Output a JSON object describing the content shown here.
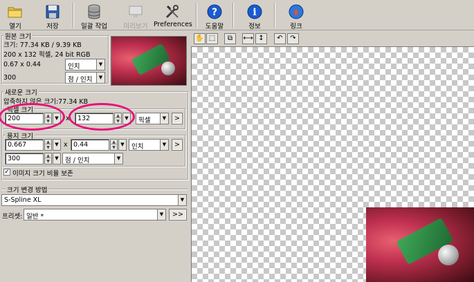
{
  "toolbar": {
    "open": "열기",
    "save": "저장",
    "batch": "일괄 작업",
    "preview": "미리보기",
    "preferences": "Preferences",
    "help": "도움말",
    "info": "정보",
    "link": "링크"
  },
  "original": {
    "title": "원본 크기",
    "size": "크기: 77.34 KB / 9.39 KB",
    "dims": "200 x 132 픽셀, 24 bit RGB",
    "inches": "0.67 x 0.44",
    "inches_unit": "인치",
    "dpi": "300",
    "dpi_unit": "점 / 인치"
  },
  "new_size": {
    "title": "새로운 크기",
    "uncompressed": "압축하지 않은 크기:77.34 KB",
    "pixel_group": "픽셀 크기",
    "width_px": "200",
    "height_px": "132",
    "px_unit": "픽셀",
    "print_group": "용지 크기",
    "width_in": "0.667",
    "x_sep": "x",
    "height_in": "0.44",
    "in_unit": "인치",
    "dpi": "300",
    "dpi_unit": "점 / 인치",
    "arrow_btn": ">",
    "keep_ratio": "이미지 크기 비율 보존"
  },
  "method": {
    "title": "크기 변경 방법",
    "algorithm": "S-Spline XL",
    "preset_label": "프리셋:",
    "preset_value": "일반 *",
    "preset_btn": ">>"
  },
  "viewer": {
    "hand": "✋",
    "select": "⬚",
    "crop": "⧉",
    "flip_h": "⟷",
    "flip_v": "↕",
    "rot_left": "↶",
    "rot_right": "↷"
  },
  "colors": {
    "highlight": "#e8107a",
    "help_blue": "#1a5bd1"
  }
}
